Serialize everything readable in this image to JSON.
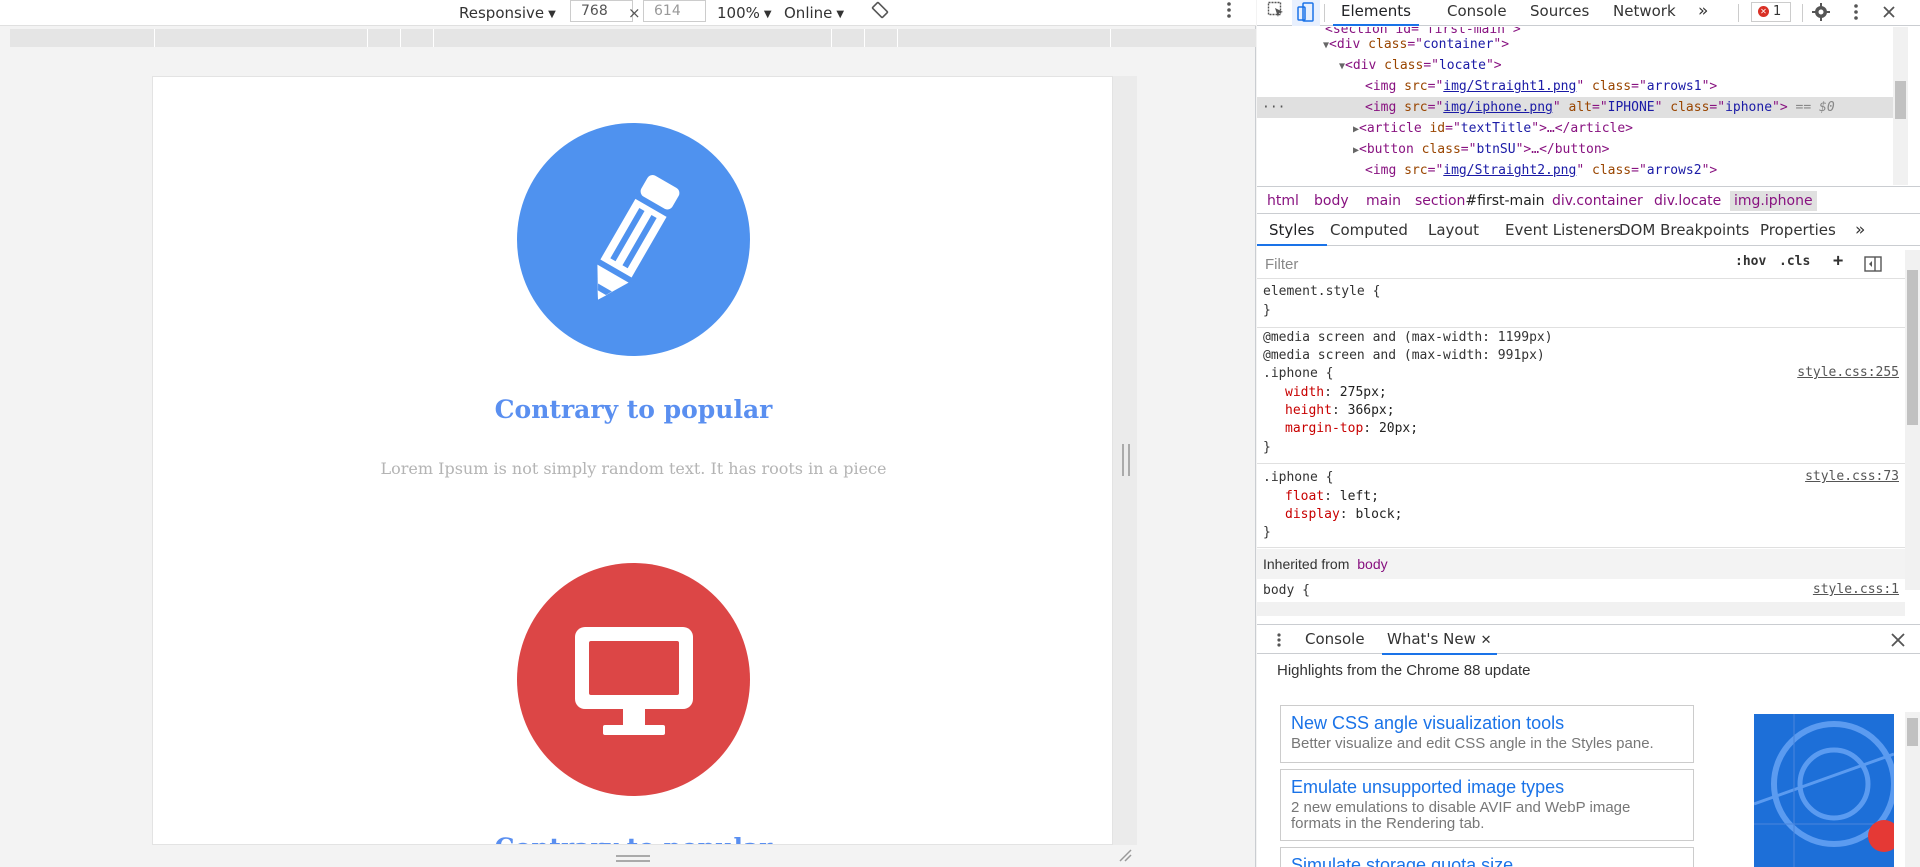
{
  "emulation": {
    "device_mode": "Responsive",
    "width": "768",
    "height": "614",
    "times": "×",
    "zoom": "100%",
    "network": "Online"
  },
  "page": {
    "features": [
      {
        "title": "Contrary to popular",
        "text": "Lorem Ipsum is not simply random text. It has roots in a piece",
        "color": "#4f92ef",
        "icon": "pencil-icon"
      },
      {
        "title": "Contrary to popular",
        "color": "#dc4646",
        "icon": "monitor-icon"
      }
    ]
  },
  "devtools": {
    "tabs": [
      "Elements",
      "Console",
      "Sources",
      "Network"
    ],
    "more_tabs": "»",
    "error_count": "1",
    "dom": [
      {
        "open": "<section id=\"first-main\">"
      },
      {
        "tag": "div",
        "attr": "class",
        "value": "container"
      },
      {
        "tag": "div",
        "attr": "class",
        "value": "locate"
      },
      {
        "src": "img/Straight1.png",
        "cls": "arrows1"
      },
      {
        "src": "img/iphone.png",
        "alt": "IPHONE",
        "cls": "iphone",
        "selected_marker": "== $0"
      },
      {
        "collapsed_tag": "article",
        "id": "textTitle"
      },
      {
        "collapsed_tag": "button",
        "cls": "btnSU"
      },
      {
        "src": "img/Straight2.png",
        "cls": "arrows2"
      }
    ],
    "breadcrumbs": [
      "html",
      "body",
      "main",
      "section",
      "#first-main",
      "div.container",
      "div.locate",
      "img.iphone"
    ],
    "sub_tabs": [
      "Styles",
      "Computed",
      "Layout",
      "Event Listeners",
      "DOM Breakpoints",
      "Properties"
    ],
    "filter_placeholder": "Filter",
    "filter_buttons": [
      ":hov",
      ".cls",
      "+"
    ],
    "styles": {
      "element_style": "element.style {",
      "close": "}",
      "media1": "@media screen and (max-width: 1199px)",
      "media2": "@media screen and (max-width: 991px)",
      "rule1_selector": ".iphone {",
      "rule1_source": "style.css:255",
      "rule1_props": [
        {
          "name": "width",
          "value": "275px;"
        },
        {
          "name": "height",
          "value": "366px;"
        },
        {
          "name": "margin-top",
          "value": "20px;"
        }
      ],
      "rule2_selector": ".iphone {",
      "rule2_source": "style.css:73",
      "rule2_props": [
        {
          "name": "float",
          "value": "left;"
        },
        {
          "name": "display",
          "value": "block;"
        }
      ],
      "inherited_label": "Inherited from",
      "inherited_tag": "body",
      "body_selector": "body {",
      "body_source": "style.css:1"
    },
    "drawer": {
      "tabs": [
        "Console",
        "What's New"
      ],
      "heading": "Highlights from the Chrome 88 update",
      "cards": [
        {
          "title": "New CSS angle visualization tools",
          "desc": "Better visualize and edit CSS angle in the Styles pane."
        },
        {
          "title": "Emulate unsupported image types",
          "desc": "2 new emulations to disable AVIF and WebP image formats in the Rendering tab."
        },
        {
          "title": "Simulate storage quota size",
          "desc": ""
        }
      ]
    }
  }
}
